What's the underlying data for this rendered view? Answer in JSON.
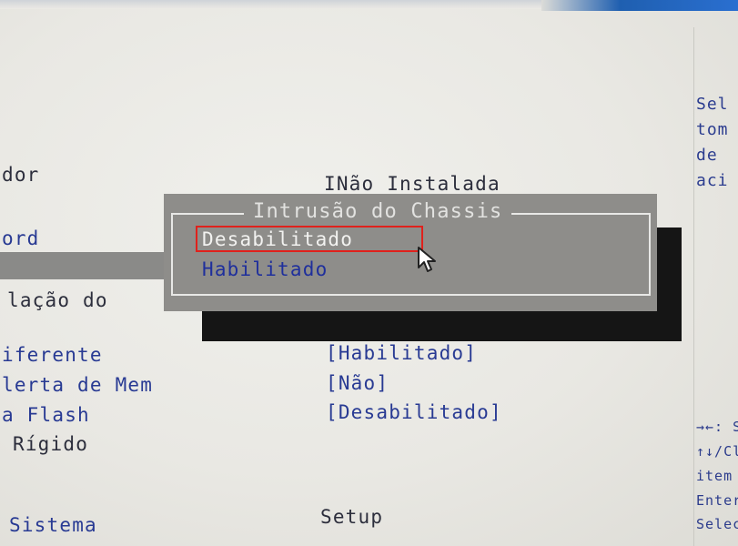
{
  "left_menu": {
    "items": [
      "dor",
      "ord",
      "lação do",
      "iferente",
      "lerta de Mem",
      "a Flash",
      "Rígido",
      "Sistema"
    ]
  },
  "values": {
    "chassis": "INão Instalada",
    "v1": "[Habilitado]",
    "v2": "[Não]",
    "v3": "[Desabilitado]",
    "setup": "Setup"
  },
  "popup": {
    "title": "Intrusão do Chassis",
    "options": [
      "Desabilitado",
      "Habilitado"
    ],
    "selected": "Desabilitado"
  },
  "help": {
    "lines": [
      "Sel",
      "tom",
      "de",
      "aci"
    ]
  },
  "nav_help": {
    "lines": [
      "→←: S",
      "↑↓/Cl",
      "item",
      "Enter/",
      "Seleci"
    ]
  },
  "colors": {
    "text_blue": "#283a93",
    "popup_bg": "#8e8d8a",
    "highlight_box": "#e0211c"
  }
}
